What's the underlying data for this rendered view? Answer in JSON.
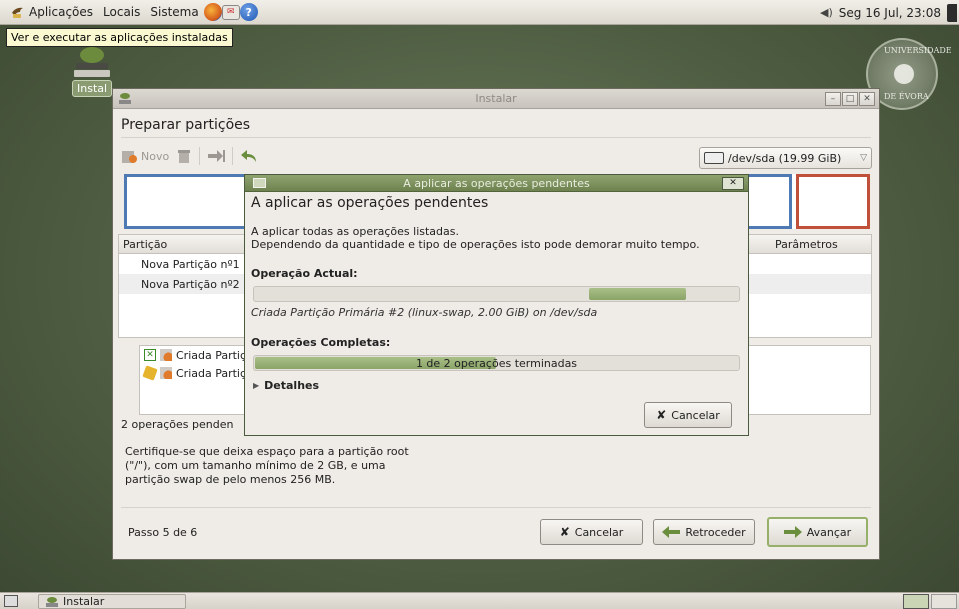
{
  "top_panel": {
    "menus": [
      "Aplicações",
      "Locais",
      "Sistema"
    ],
    "clock": "Seg 16 Jul, 23:08"
  },
  "tooltip": "Ver e executar as aplicações instaladas",
  "desktop_icon": {
    "label": "Instal"
  },
  "seal": {
    "top_text": "UNIVERSIDADE",
    "bottom_text": "DE ÉVORA"
  },
  "window": {
    "title": "Instalar",
    "page_title": "Preparar partições",
    "toolbar": {
      "new_label": "Novo"
    },
    "device": "/dev/sda  (19.99 GiB)",
    "table": {
      "col_partition": "Partição",
      "col_params": "Parâmetros",
      "rows": [
        "Nova Partição nº1",
        "Nova Partição nº2"
      ]
    },
    "operations": [
      "Criada Partiçã",
      "Criada Partiçã"
    ],
    "pending_text": "2 operações penden",
    "info_lines": [
      "Certifique-se que deixa espaço para a partição root",
      "(\"/\"), com um tamanho mínimo de 2 GB, e uma",
      "partição swap de pelo menos 256 MB."
    ],
    "footer": {
      "step": "Passo 5 de 6",
      "cancel": "Cancelar",
      "back": "Retroceder",
      "forward": "Avançar"
    }
  },
  "dialog": {
    "title": "A aplicar as operações pendentes",
    "heading": "A aplicar as operações pendentes",
    "line1": "A aplicar todas as operações listadas.",
    "line2": "Dependendo da quantidade e tipo de operações isto pode demorar muito tempo.",
    "current_label": "Operação Actual:",
    "current_op": "Criada Partição Primária #2 (linux-swap, 2.00 GiB) on /dev/sda",
    "completed_label": "Operações Completas:",
    "completed_text": "1 de 2 operações terminadas",
    "completed_fraction": 0.5,
    "details_label": "Detalhes",
    "cancel": "Cancelar"
  },
  "taskbar": {
    "item": "Instalar"
  },
  "colors": {
    "dialog_title": "#7a8f5a",
    "progress": "#9bb276",
    "partition_blue": "#4f79b3",
    "partition_red": "#c1503b"
  }
}
